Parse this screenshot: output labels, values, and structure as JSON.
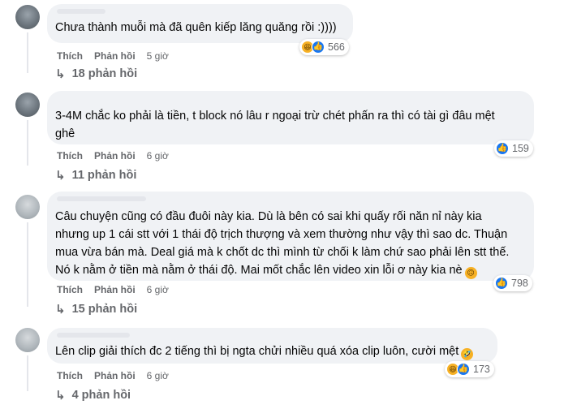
{
  "comments": [
    {
      "text": "Chưa thành muỗi mà đã quên kiếp lăng quăng rồi :))))",
      "reactions": [
        "haha",
        "like"
      ],
      "reaction_count": "566",
      "like_label": "Thích",
      "reply_label": "Phản hồi",
      "time": "5 giờ",
      "replies_label": "18 phản hồi"
    },
    {
      "text": "3-4M chắc ko phải là tiền, t block nó lâu r ngoại trừ chét phấn ra thì có tài gì đâu mệt\nghê",
      "reactions": [
        "like"
      ],
      "reaction_count": "159",
      "like_label": "Thích",
      "reply_label": "Phản hồi",
      "time": "6 giờ",
      "replies_label": "11 phản hồi"
    },
    {
      "text": "Câu chuyện cũng có đầu đuôi này kia. Dù là bên có sai khi quấy rối năn nỉ này kia\nnhưng up 1 cái stt với 1 thái độ trịch thượng và xem thường như vậy thì sao dc. Thuận\nmua vừa bán mà. Deal giá mà k chốt dc thì mình từ chối k làm chứ sao phải lên stt thế.\nNó k nằm ở tiền mà nằm ở thái độ. Mai mốt chắc lên video xin lỗi ơ này kia nè",
      "reactions": [
        "like",
        "like"
      ],
      "reaction_count": "798",
      "like_label": "Thích",
      "reply_label": "Phản hồi",
      "time": "6 giờ",
      "replies_label": "15 phản hồi"
    },
    {
      "text": "Lên clip giải thích đc 2 tiếng thì bị ngta chửi nhiều quá xóa clip luôn, cười mệt",
      "reactions": [
        "haha",
        "like"
      ],
      "reaction_count": "173",
      "like_label": "Thích",
      "reply_label": "Phản hồi",
      "time": "6 giờ",
      "replies_label": "4 phản hồi"
    }
  ],
  "icons": {
    "reply_arrow": "↳",
    "like": "👍",
    "haha": "😆",
    "inline_emoji": "🙃"
  },
  "colors": {
    "bubble": "#f0f2f5",
    "like_blue": "#1877f2",
    "haha_yellow": "#f7b125",
    "meta_gray": "#65676b"
  }
}
